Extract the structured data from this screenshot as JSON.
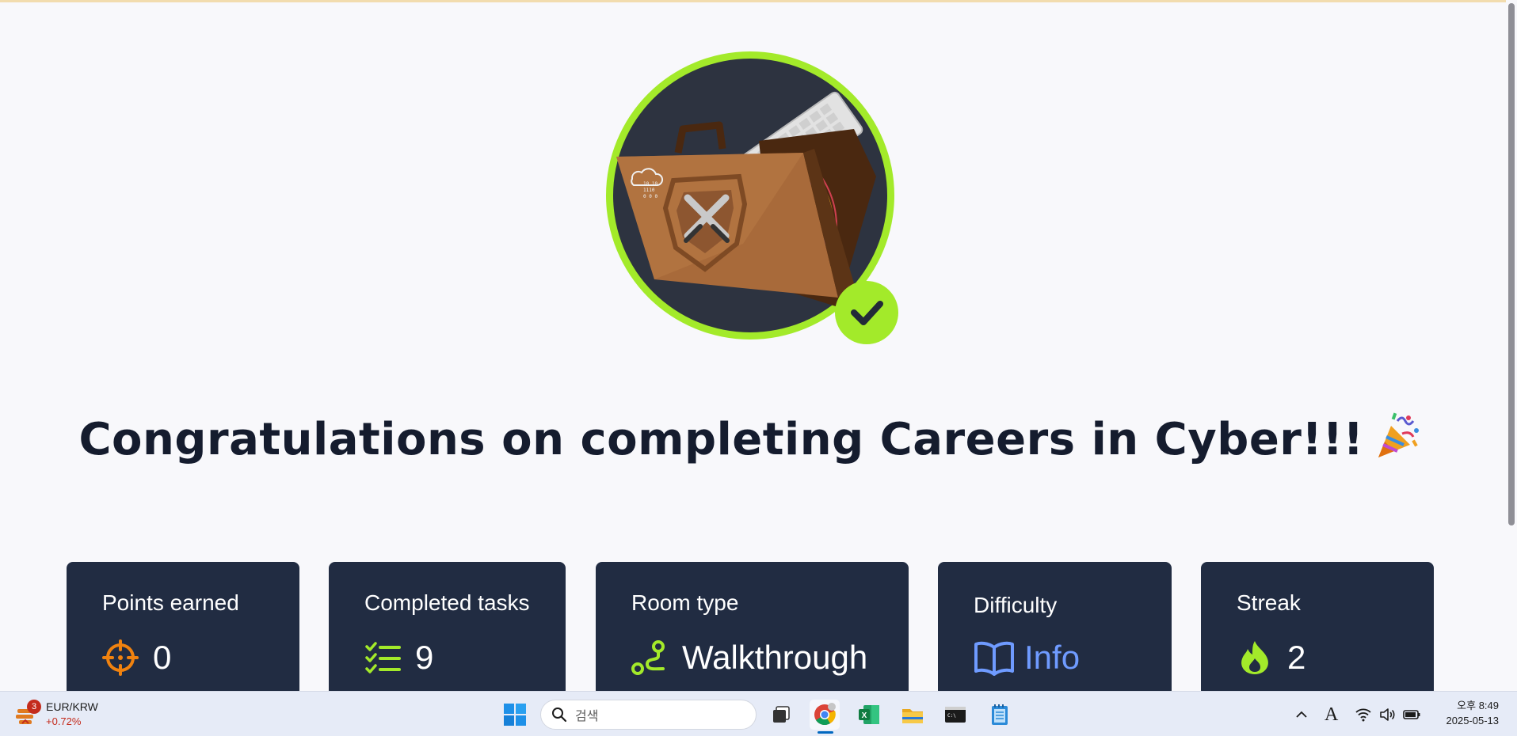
{
  "page": {
    "title": "Congratulations on completing Careers in Cyber!!!"
  },
  "stats": [
    {
      "label": "Points earned",
      "value": "0",
      "icon": "crosshair-icon"
    },
    {
      "label": "Completed tasks",
      "value": "9",
      "icon": "checklist-icon"
    },
    {
      "label": "Room type",
      "value": "Walkthrough",
      "icon": "path-icon"
    },
    {
      "label": "Difficulty",
      "value": "Info",
      "icon": "book-icon"
    },
    {
      "label": "Streak",
      "value": "2",
      "icon": "flame-icon"
    }
  ],
  "taskbar": {
    "widget": {
      "title": "EUR/KRW",
      "change": "+0.72%",
      "badge": "3"
    },
    "search_placeholder": "검색",
    "apps": [
      "task-view",
      "chrome",
      "excel",
      "file-explorer",
      "terminal",
      "notepad"
    ],
    "clock": {
      "time": "오후 8:49",
      "date": "2025-05-13"
    },
    "ime": "A"
  },
  "colors": {
    "accent_green": "#a3ea2a",
    "card_bg": "#212c42",
    "info_blue": "#6f9bff",
    "points_orange": "#f0820f"
  }
}
